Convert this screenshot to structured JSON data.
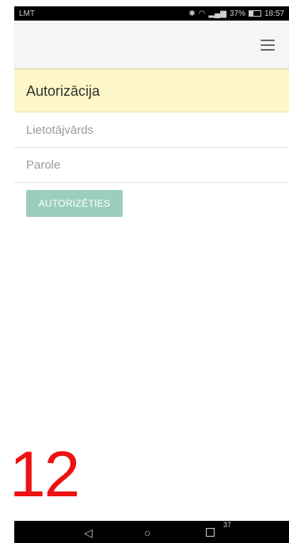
{
  "status_bar": {
    "carrier": "LMT",
    "battery_percent_text": "37%",
    "battery_level": 0.37,
    "time": "18:57",
    "icons": [
      "bluetooth-icon",
      "wifi-icon",
      "signal-icon",
      "battery-icon"
    ]
  },
  "navbar": {
    "menu_icon": "hamburger-menu-icon"
  },
  "panel": {
    "title": "Autorizācija"
  },
  "form": {
    "username_placeholder": "Lietotājvārds",
    "password_placeholder": "Parole",
    "submit_label": "AUTORIZĒTIES"
  },
  "annotation": {
    "text": "12"
  },
  "system_nav": {
    "back_icon": "back-triangle-icon",
    "home_icon": "home-circle-icon",
    "recent_icon": "recent-square-icon",
    "badge": "37"
  },
  "colors": {
    "heading_bg": "#fcf6c8",
    "button_bg": "#9ccfbb",
    "annotation": "#ee1111"
  }
}
